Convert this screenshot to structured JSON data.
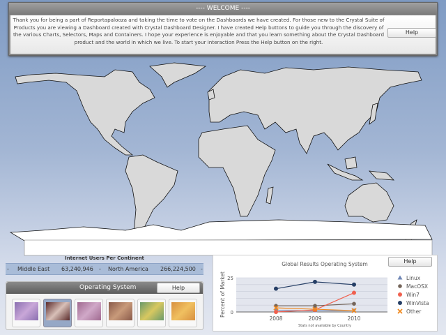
{
  "welcome": {
    "title": "---- WELCOME ----",
    "text": "Thank you for being a part of Reportapalooza and taking the time to vote on the Dashboards we have created. For those new to the Crystal Suite of Products you are viewing a Dashboard created with Crystal Dashboard Designer. I have created Help buttons to guide you through the discovery of the various Charts, Selectors, Maps and Containers. I hope your experience is enjoyable and that you learn something about the Crystal Dashboard product and the world in which we live. To start your interaction Press the Help button on the right.",
    "help_label": "Help"
  },
  "internet_users": {
    "title": "Internet Users Per Continent",
    "items": [
      {
        "sep": "-",
        "name": "Middle East",
        "value": "63,240,946"
      },
      {
        "sep": "-",
        "name": "North America",
        "value": "266,224,500"
      }
    ],
    "trail": "-"
  },
  "os_panel": {
    "title": "Operating System",
    "help_label": "Help",
    "thumbnails": [
      {
        "name": "Linux",
        "colors": [
          "#8a6fb0",
          "#c9a7d8"
        ]
      },
      {
        "name": "MacOSX",
        "colors": [
          "#5a2a2a",
          "#d8c0b8"
        ],
        "selected": true
      },
      {
        "name": "Win7",
        "colors": [
          "#a06a90",
          "#d0a8c8"
        ]
      },
      {
        "name": "WinVista",
        "colors": [
          "#8a5a4a",
          "#c89a7a"
        ]
      },
      {
        "name": "Other-1",
        "colors": [
          "#6a9a6a",
          "#d8c860"
        ]
      },
      {
        "name": "Other-2",
        "colors": [
          "#d89040",
          "#f0c060"
        ]
      }
    ]
  },
  "chart_panel": {
    "help_label": "Help"
  },
  "chart_data": {
    "type": "line",
    "title": "Global Results Operating System",
    "ylabel": "Percent of Market",
    "footnote": "Stats not available by Country",
    "categories": [
      "2008",
      "2009",
      "2010"
    ],
    "ylim": [
      0,
      25
    ],
    "yticks": [
      "0",
      "25"
    ],
    "grid": true,
    "legend_position": "right",
    "series": [
      {
        "name": "Linux",
        "color": "#6f86b5",
        "marker": "triangle",
        "values": [
          1,
          1,
          1
        ]
      },
      {
        "name": "MacOSX",
        "color": "#74655a",
        "marker": "gear",
        "values": [
          4.5,
          4.5,
          6
        ]
      },
      {
        "name": "Win7",
        "color": "#f0604e",
        "marker": "circle",
        "values": [
          0,
          1.5,
          14
        ]
      },
      {
        "name": "WinVista",
        "color": "#263f66",
        "marker": "circle",
        "values": [
          17,
          22,
          20
        ]
      },
      {
        "name": "Other",
        "color": "#f08a20",
        "marker": "x",
        "values": [
          3,
          2,
          1
        ]
      }
    ]
  }
}
